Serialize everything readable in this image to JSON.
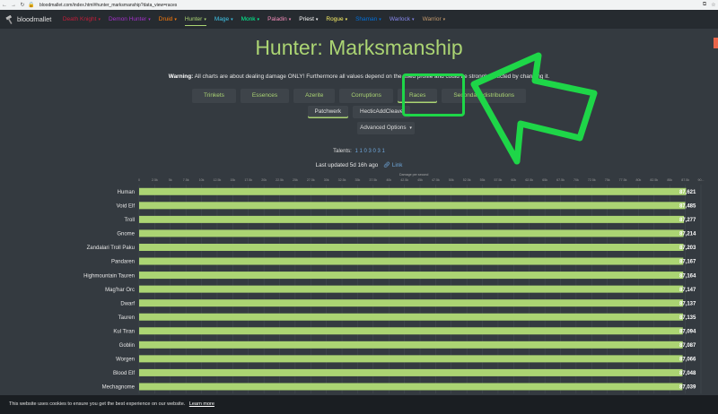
{
  "browser": {
    "url": "bloodmallet.com/index.html#hunter_marksmanship?data_view=races",
    "back_glyph": "←",
    "forward_glyph": "→",
    "reload_glyph": "↻"
  },
  "nav": {
    "brand": "bloodmallet",
    "items": [
      {
        "label": "Death Knight",
        "color": "#C41E3A"
      },
      {
        "label": "Demon Hunter",
        "color": "#A330C9"
      },
      {
        "label": "Druid",
        "color": "#FF7C0A"
      },
      {
        "label": "Hunter",
        "color": "#ABD473",
        "active": true
      },
      {
        "label": "Mage",
        "color": "#3FC7EB"
      },
      {
        "label": "Monk",
        "color": "#00FF98"
      },
      {
        "label": "Paladin",
        "color": "#F48CBA"
      },
      {
        "label": "Priest",
        "color": "#FFFFFF"
      },
      {
        "label": "Rogue",
        "color": "#FFF468"
      },
      {
        "label": "Shaman",
        "color": "#0070DD"
      },
      {
        "label": "Warlock",
        "color": "#8788EE"
      },
      {
        "label": "Warrior",
        "color": "#C69B6D"
      }
    ]
  },
  "page": {
    "title": "Hunter: Marksmanship",
    "warning_label": "Warning:",
    "warning_text": "All charts are about dealing damage ONLY! Furthermore all values depend on the used profile and could be strongly affected by changing it."
  },
  "tabs": [
    "Trinkets",
    "Essences",
    "Azerite",
    "Corruptions",
    "Races",
    "Secondary distributions"
  ],
  "subtabs": [
    "Patchwerk",
    "HecticAddCleave"
  ],
  "advanced_options": "Advanced Options",
  "talents": {
    "label": "Talents:",
    "value": "1 1 0 3 0 3 1"
  },
  "updated": {
    "text": "Last updated 5d 16h ago",
    "link": "Link"
  },
  "chart_data": {
    "type": "bar",
    "orientation": "horizontal",
    "xlabel": "Damage per second",
    "bar_color": "#ABD473",
    "xlim": [
      0,
      90000
    ],
    "x_ticks": [
      "0",
      "2.5k",
      "5k",
      "7.5k",
      "10k",
      "12.5k",
      "15k",
      "17.5k",
      "20k",
      "22.5k",
      "25k",
      "27.5k",
      "30k",
      "32.5k",
      "35k",
      "37.5k",
      "40k",
      "42.5k",
      "45k",
      "47.5k",
      "50k",
      "52.5k",
      "55k",
      "57.5k",
      "60k",
      "62.5k",
      "65k",
      "67.5k",
      "70k",
      "72.5k",
      "75k",
      "77.5k",
      "80k",
      "82.5k",
      "85k",
      "87.5k",
      "90..."
    ],
    "categories": [
      "Human",
      "Void Elf",
      "Troll",
      "Gnome",
      "Zandalari Troll Paku",
      "Pandaren",
      "Highmountain Tauren",
      "Mag'har Orc",
      "Dwarf",
      "Tauren",
      "Kul Tiran",
      "Goblin",
      "Worgen",
      "Blood Elf",
      "Mechagnome"
    ],
    "values": [
      87621,
      87485,
      87277,
      87214,
      87203,
      87167,
      87164,
      87147,
      87137,
      87135,
      87094,
      87087,
      87066,
      87048,
      87039
    ],
    "value_labels": [
      "87,621",
      "87,485",
      "87,277",
      "87,214",
      "87,203",
      "87,167",
      "87,164",
      "87,147",
      "87,137",
      "87,135",
      "87,094",
      "87,087",
      "87,066",
      "87,048",
      "87,039"
    ]
  },
  "cookie": {
    "text": "This website uses cookies to ensure you get the best experience on our website.",
    "link": "Learn more"
  },
  "annotation": {
    "color": "#1ed648"
  }
}
